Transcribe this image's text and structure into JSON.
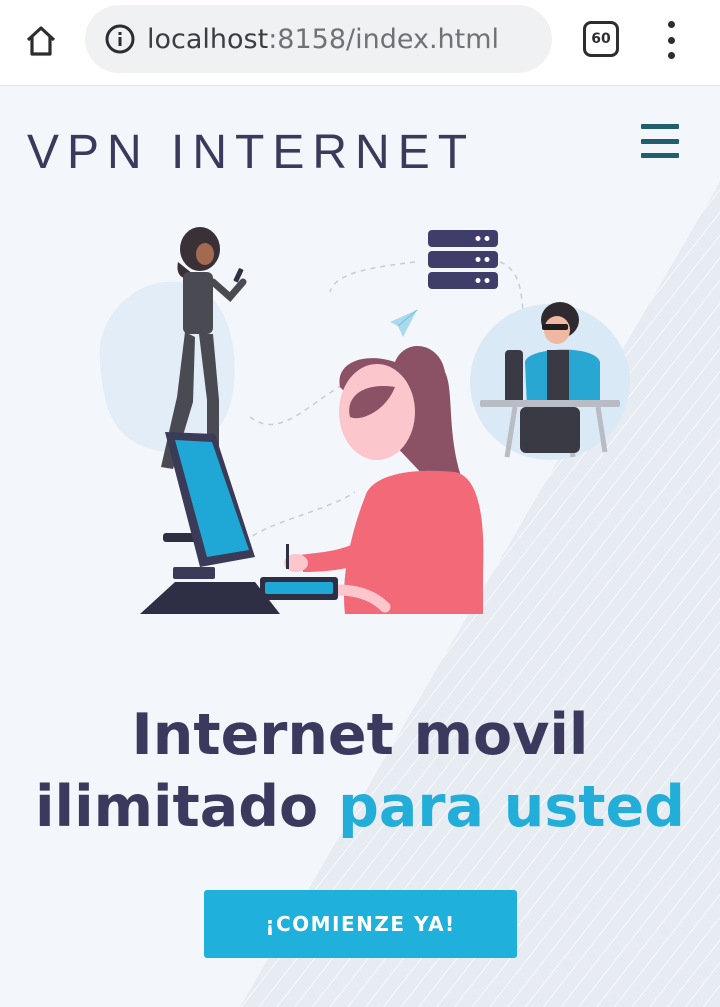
{
  "browser": {
    "url_host": "localhost",
    "url_rest": ":8158/index.html",
    "tab_count": "60"
  },
  "header": {
    "brand": "VPN INTERNET"
  },
  "hero": {
    "headline_line1": "Internet movil",
    "headline_line2_plain": "ilimitado ",
    "headline_line2_accent": "para usted",
    "cta_label": "¡COMIENZE YA!"
  },
  "colors": {
    "brand_text": "#3a3b5c",
    "accent": "#22aed8",
    "cta_bg": "#1fb0db",
    "hamburger": "#1f5f6e"
  },
  "icons": [
    "home-icon",
    "info-icon",
    "tabs-count-icon",
    "more-vert-icon",
    "hamburger-menu-icon",
    "paper-plane-icon",
    "server-icon"
  ]
}
